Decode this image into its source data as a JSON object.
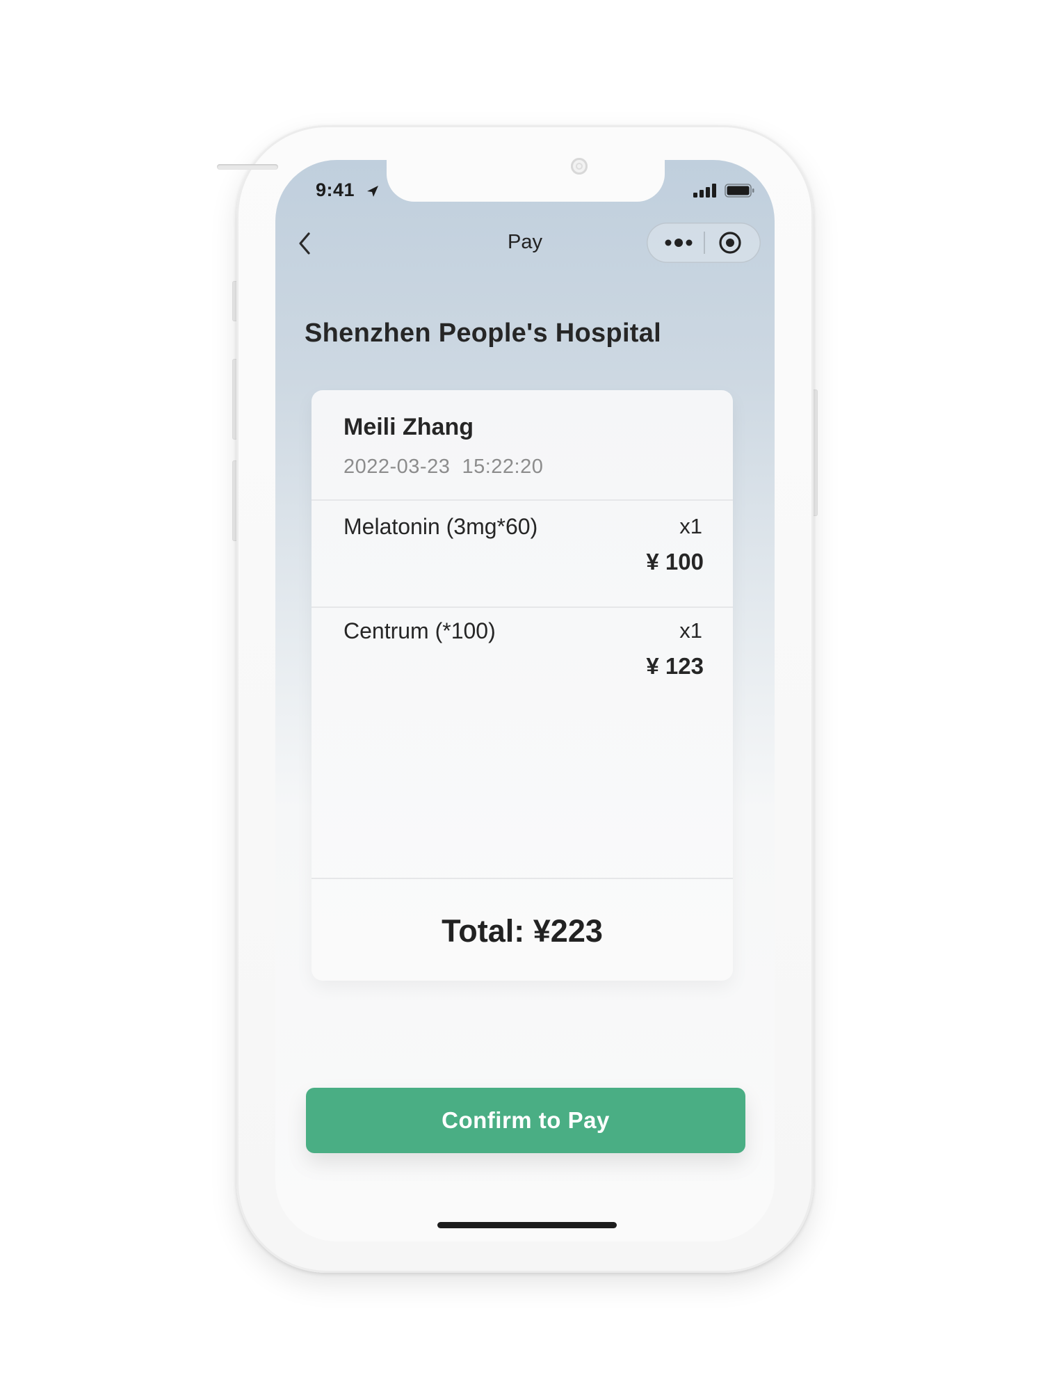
{
  "status_bar": {
    "time": "9:41",
    "icons": [
      "location-arrow-icon",
      "signal-icon",
      "battery-icon"
    ]
  },
  "nav": {
    "title": "Pay",
    "icons": [
      "back-chevron-icon",
      "more-dots-icon",
      "close-target-icon"
    ]
  },
  "hospital_name": "Shenzhen People's Hospital",
  "patient": {
    "name": "Meili Zhang",
    "datetime": "2022-03-23  15:22:20"
  },
  "items": [
    {
      "name": "Melatonin (3mg*60)",
      "qty": "x1",
      "price": "¥ 100"
    },
    {
      "name": "Centrum (*100)",
      "qty": "x1",
      "price": "¥ 123"
    }
  ],
  "total": "Total: ¥223",
  "confirm_label": "Confirm to Pay",
  "colors": {
    "accent": "#4aae84",
    "header_gradient_top": "#c0cfdd",
    "text_primary": "#262626",
    "text_secondary": "#8c8c8c"
  }
}
